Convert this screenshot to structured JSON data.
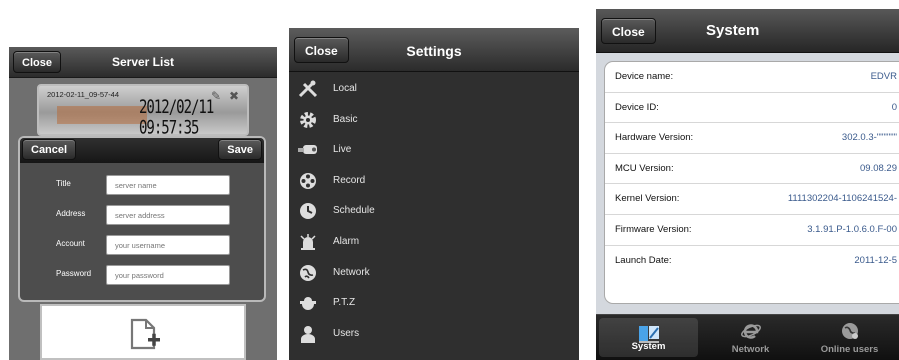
{
  "server_list": {
    "close_label": "Close",
    "title": "Server List",
    "thumbnail": {
      "filename": "2012-02-11_09-57-44",
      "osd_time": "2012/02/11 09:57:35"
    },
    "dialog": {
      "cancel_label": "Cancel",
      "save_label": "Save",
      "fields": [
        {
          "label": "Title",
          "placeholder": "server name"
        },
        {
          "label": "Address",
          "placeholder": "server address"
        },
        {
          "label": "Account",
          "placeholder": "your username"
        },
        {
          "label": "Password",
          "placeholder": "your password"
        }
      ]
    },
    "add_icon": "add-file-icon"
  },
  "settings": {
    "close_label": "Close",
    "title": "Settings",
    "items": [
      {
        "label": "Local",
        "icon": "tools-icon"
      },
      {
        "label": "Basic",
        "icon": "gear-icon"
      },
      {
        "label": "Live",
        "icon": "camera-icon"
      },
      {
        "label": "Record",
        "icon": "film-reel-icon"
      },
      {
        "label": "Schedule",
        "icon": "clock-icon"
      },
      {
        "label": "Alarm",
        "icon": "alarm-icon"
      },
      {
        "label": "Network",
        "icon": "globe-icon"
      },
      {
        "label": "P.T.Z",
        "icon": "ptz-camera-icon"
      },
      {
        "label": "Users",
        "icon": "user-icon"
      }
    ]
  },
  "system": {
    "close_label": "Close",
    "title": "System",
    "rows": [
      {
        "key": "Device name:",
        "value": "EDVR"
      },
      {
        "key": "Device ID:",
        "value": "0"
      },
      {
        "key": "Hardware Version:",
        "value": "302.0.3-\"\"\"\"\"\""
      },
      {
        "key": "MCU Version:",
        "value": "09.08.29"
      },
      {
        "key": "Kernel Version:",
        "value": "1111302204-1106241524-"
      },
      {
        "key": "Firmware Version:",
        "value": "3.1.91.P-1.0.6.0.F-00"
      },
      {
        "key": "Launch Date:",
        "value": "2011-12-5"
      }
    ],
    "tabs": [
      {
        "label": "System",
        "icon": "system-icon",
        "active": true
      },
      {
        "label": "Network",
        "icon": "network-e-icon",
        "active": false
      },
      {
        "label": "Online users",
        "icon": "online-users-icon",
        "active": false
      }
    ]
  },
  "colors": {
    "navbar": "#2c2c2c",
    "value_text": "#3a5a8c",
    "table_bg": "#ffffff",
    "page_bg": "#d4d8de"
  }
}
